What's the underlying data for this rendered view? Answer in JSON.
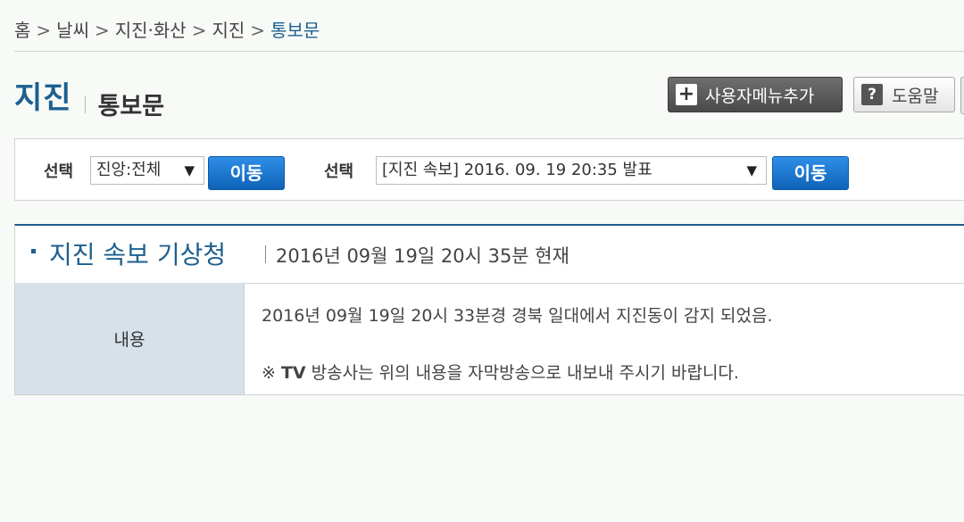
{
  "breadcrumb": {
    "items": [
      "홈",
      "날씨",
      "지진·화산",
      "지진"
    ],
    "current": "통보문",
    "separator": ">"
  },
  "header": {
    "title": "지진",
    "subtitle": "통보문",
    "user_menu_label": "사용자메뉴추가",
    "help_label": "도움말"
  },
  "filter": {
    "label1": "선택",
    "select1_value": "진앙:전체",
    "go1_label": "이동",
    "label2": "선택",
    "select2_value": "[지진 속보] 2016. 09. 19 20:35 발표",
    "go2_label": "이동"
  },
  "bulletin": {
    "title": "지진 속보 기상청",
    "timestamp": "2016년 09월 19일 20시 35분 현재",
    "content_label": "내용",
    "line1": "2016년 09월 19일 20시 33분경 경북 일대에서 지진동이 감지 되었음.",
    "line2_prefix": "※ ",
    "line2_tv": "TV",
    "line2_rest": " 방송사는 위의 내용을 자막방송으로 내보내 주시기 바랍니다."
  },
  "colors": {
    "accent": "#1d5f8f",
    "button_blue": "#1673d0",
    "label_bg": "#d6e1ea"
  }
}
